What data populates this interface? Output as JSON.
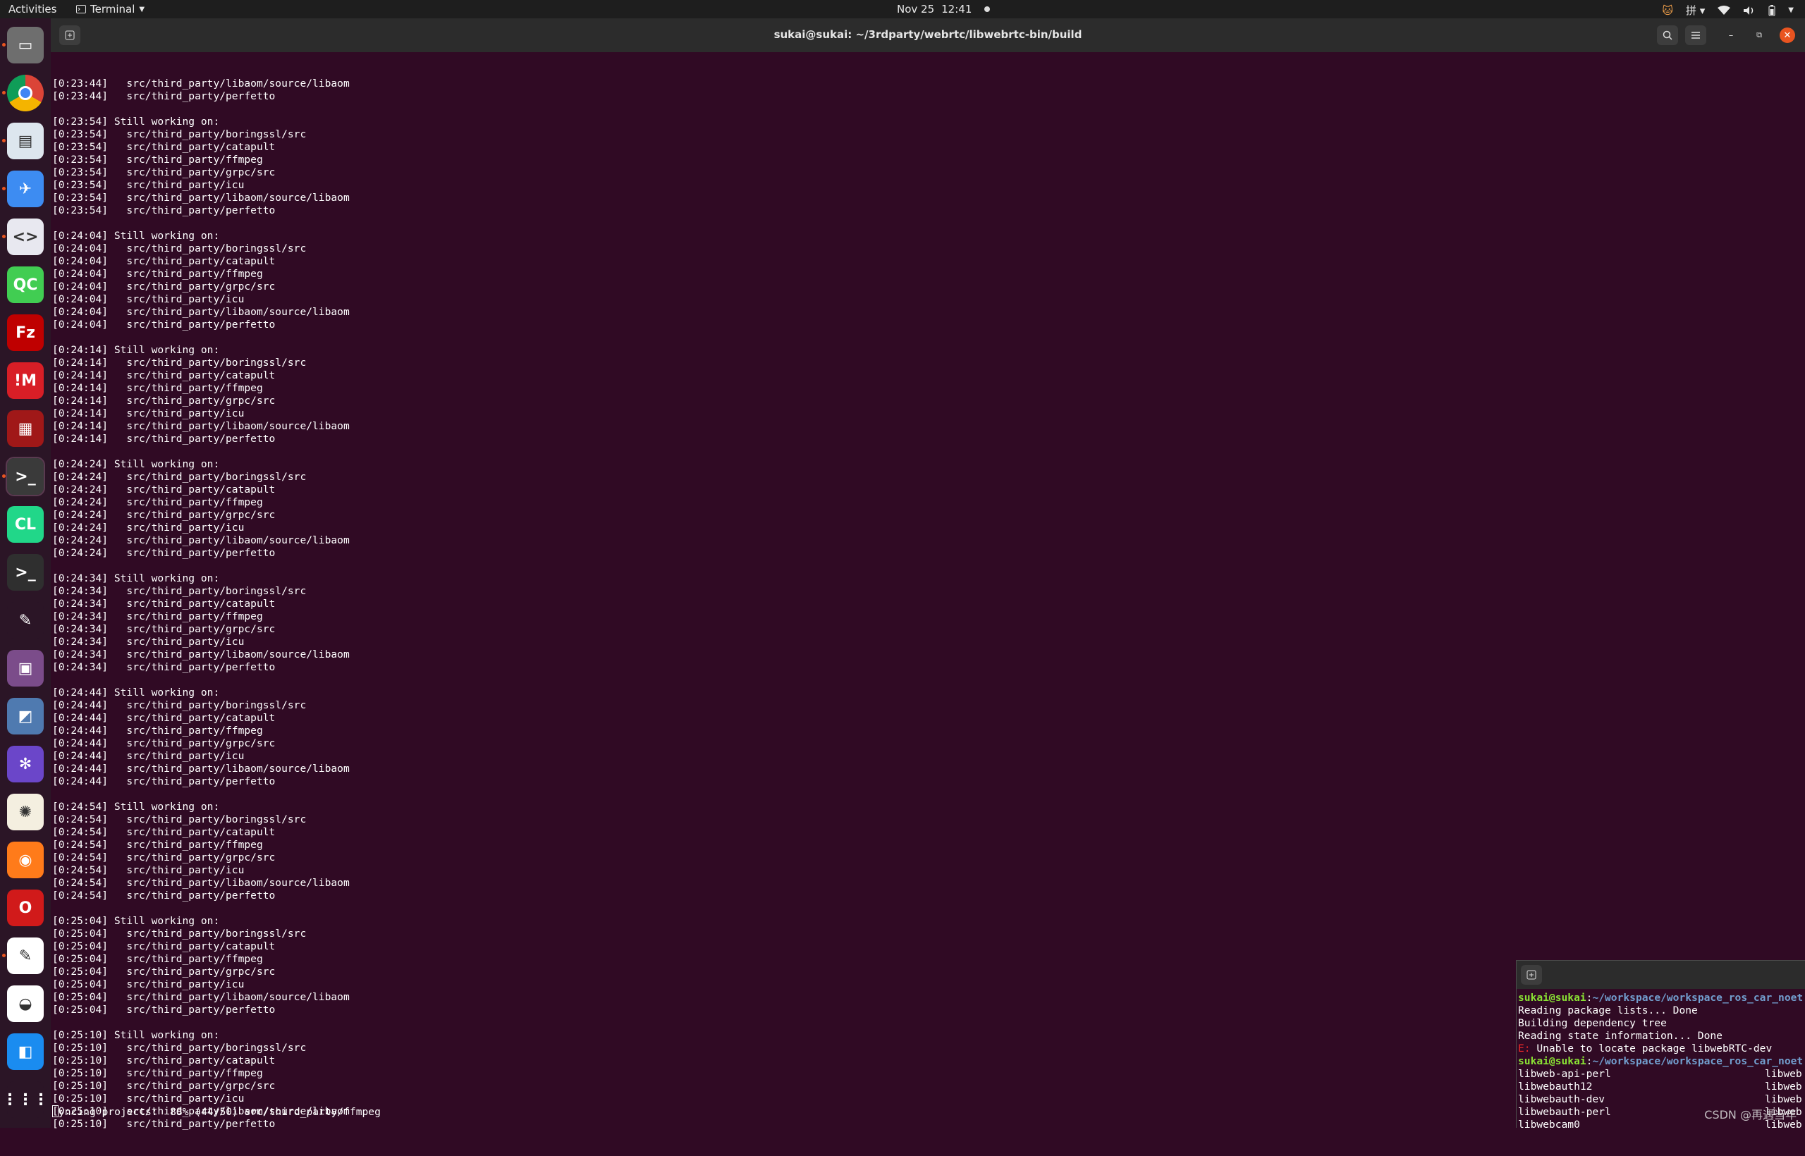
{
  "topbar": {
    "activities": "Activities",
    "app_menu": "Terminal",
    "date": "Nov 25",
    "time": "12:41",
    "input_method": "拼"
  },
  "window": {
    "title": "sukai@sukai: ~/3rdparty/webrtc/libwebrtc-bin/build"
  },
  "dock": {
    "apps": [
      {
        "name": "files",
        "color": "#6e6e6e",
        "glyph": "▭",
        "running": true
      },
      {
        "name": "chrome",
        "color": "#ffffff",
        "glyph": "",
        "running": true
      },
      {
        "name": "remote-desktop",
        "color": "#dde6ee",
        "glyph": "▤",
        "running": true
      },
      {
        "name": "feishu",
        "color": "#3d8cf2",
        "glyph": "✈",
        "running": true
      },
      {
        "name": "code-editor",
        "color": "#e8e8f0",
        "glyph": "<>",
        "running": true
      },
      {
        "name": "qt-creator",
        "color": "#41cd52",
        "glyph": "QC",
        "running": false
      },
      {
        "name": "filezilla",
        "color": "#bf0000",
        "glyph": "Fz",
        "running": false
      },
      {
        "name": "meld",
        "color": "#d81e26",
        "glyph": "!M",
        "running": false
      },
      {
        "name": "screen-recorder",
        "color": "#a01818",
        "glyph": "▦",
        "running": false
      },
      {
        "name": "terminal",
        "color": "#3a3a3a",
        "glyph": ">_",
        "running": true
      },
      {
        "name": "clion",
        "color": "#21d789",
        "glyph": "CL",
        "running": false
      },
      {
        "name": "terminal-2",
        "color": "#2f2f2f",
        "glyph": ">_",
        "running": false
      },
      {
        "name": "gimp",
        "color": "#2b1526",
        "glyph": "✎",
        "running": false
      },
      {
        "name": "video-player",
        "color": "#7b4c8a",
        "glyph": "▣",
        "running": false
      },
      {
        "name": "remmina",
        "color": "#4f7ab0",
        "glyph": "◩",
        "running": false
      },
      {
        "name": "slack-like",
        "color": "#6b46c9",
        "glyph": "✻",
        "running": false
      },
      {
        "name": "settings-tool",
        "color": "#f4efe0",
        "glyph": "✺",
        "running": false
      },
      {
        "name": "firefox",
        "color": "#ff7b1a",
        "glyph": "◉",
        "running": false
      },
      {
        "name": "opera",
        "color": "#d11a1a",
        "glyph": "O",
        "running": false
      },
      {
        "name": "text-editor",
        "color": "#ffffff",
        "glyph": "✎",
        "running": true
      },
      {
        "name": "rviz",
        "color": "#ffffff",
        "glyph": "◒",
        "running": false
      },
      {
        "name": "lark",
        "color": "#1a8cf0",
        "glyph": "◧",
        "running": false
      },
      {
        "name": "show-apps",
        "color": "#2b1526",
        "glyph": "⋮⋮⋮",
        "running": false
      }
    ]
  },
  "terminal": {
    "lines": [
      "[0:23:44]   src/third_party/libaom/source/libaom",
      "[0:23:44]   src/third_party/perfetto",
      "",
      "[0:23:54] Still working on:",
      "[0:23:54]   src/third_party/boringssl/src",
      "[0:23:54]   src/third_party/catapult",
      "[0:23:54]   src/third_party/ffmpeg",
      "[0:23:54]   src/third_party/grpc/src",
      "[0:23:54]   src/third_party/icu",
      "[0:23:54]   src/third_party/libaom/source/libaom",
      "[0:23:54]   src/third_party/perfetto",
      "",
      "[0:24:04] Still working on:",
      "[0:24:04]   src/third_party/boringssl/src",
      "[0:24:04]   src/third_party/catapult",
      "[0:24:04]   src/third_party/ffmpeg",
      "[0:24:04]   src/third_party/grpc/src",
      "[0:24:04]   src/third_party/icu",
      "[0:24:04]   src/third_party/libaom/source/libaom",
      "[0:24:04]   src/third_party/perfetto",
      "",
      "[0:24:14] Still working on:",
      "[0:24:14]   src/third_party/boringssl/src",
      "[0:24:14]   src/third_party/catapult",
      "[0:24:14]   src/third_party/ffmpeg",
      "[0:24:14]   src/third_party/grpc/src",
      "[0:24:14]   src/third_party/icu",
      "[0:24:14]   src/third_party/libaom/source/libaom",
      "[0:24:14]   src/third_party/perfetto",
      "",
      "[0:24:24] Still working on:",
      "[0:24:24]   src/third_party/boringssl/src",
      "[0:24:24]   src/third_party/catapult",
      "[0:24:24]   src/third_party/ffmpeg",
      "[0:24:24]   src/third_party/grpc/src",
      "[0:24:24]   src/third_party/icu",
      "[0:24:24]   src/third_party/libaom/source/libaom",
      "[0:24:24]   src/third_party/perfetto",
      "",
      "[0:24:34] Still working on:",
      "[0:24:34]   src/third_party/boringssl/src",
      "[0:24:34]   src/third_party/catapult",
      "[0:24:34]   src/third_party/ffmpeg",
      "[0:24:34]   src/third_party/grpc/src",
      "[0:24:34]   src/third_party/icu",
      "[0:24:34]   src/third_party/libaom/source/libaom",
      "[0:24:34]   src/third_party/perfetto",
      "",
      "[0:24:44] Still working on:",
      "[0:24:44]   src/third_party/boringssl/src",
      "[0:24:44]   src/third_party/catapult",
      "[0:24:44]   src/third_party/ffmpeg",
      "[0:24:44]   src/third_party/grpc/src",
      "[0:24:44]   src/third_party/icu",
      "[0:24:44]   src/third_party/libaom/source/libaom",
      "[0:24:44]   src/third_party/perfetto",
      "",
      "[0:24:54] Still working on:",
      "[0:24:54]   src/third_party/boringssl/src",
      "[0:24:54]   src/third_party/catapult",
      "[0:24:54]   src/third_party/ffmpeg",
      "[0:24:54]   src/third_party/grpc/src",
      "[0:24:54]   src/third_party/icu",
      "[0:24:54]   src/third_party/libaom/source/libaom",
      "[0:24:54]   src/third_party/perfetto",
      "",
      "[0:25:04] Still working on:",
      "[0:25:04]   src/third_party/boringssl/src",
      "[0:25:04]   src/third_party/catapult",
      "[0:25:04]   src/third_party/ffmpeg",
      "[0:25:04]   src/third_party/grpc/src",
      "[0:25:04]   src/third_party/icu",
      "[0:25:04]   src/third_party/libaom/source/libaom",
      "[0:25:04]   src/third_party/perfetto",
      "",
      "[0:25:10] Still working on:",
      "[0:25:10]   src/third_party/boringssl/src",
      "[0:25:10]   src/third_party/catapult",
      "[0:25:10]   src/third_party/ffmpeg",
      "[0:25:10]   src/third_party/grpc/src",
      "[0:25:10]   src/third_party/icu",
      "[0:25:10]   src/third_party/libaom/source/libaom",
      "[0:25:10]   src/third_party/perfetto"
    ],
    "status_line": "yncing projects:  88% (44/50) src/third_party/ffmpeg"
  },
  "mini_terminal": {
    "prompt_user": "sukai@sukai",
    "prompt_path": "~/workspace/workspace_ros_car_noet",
    "lines": [
      "Reading package lists... Done",
      "Building dependency tree",
      "Reading state information... Done"
    ],
    "error_prefix": "E:",
    "error_text": " Unable to locate package libwebRTC-dev",
    "pkg_left": [
      "libweb-api-perl",
      "libwebauth12",
      "libwebauth-dev",
      "libwebauth-perl",
      "libwebcam0"
    ],
    "pkg_right": [
      "libweb",
      "libweb",
      "libweb",
      "libweb",
      "libweb"
    ]
  },
  "watermark": "CSDN @再遇当年"
}
